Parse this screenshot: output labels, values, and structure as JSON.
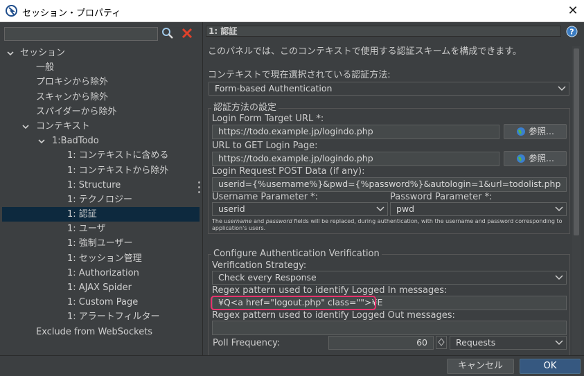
{
  "window": {
    "title": "セッション・プロパティ",
    "close_glyph": "✕"
  },
  "left": {
    "search_value": "",
    "tree": [
      {
        "label": "セッション",
        "expanded": true
      },
      {
        "label": "一般"
      },
      {
        "label": "プロキシから除外"
      },
      {
        "label": "スキャンから除外"
      },
      {
        "label": "スパイダーから除外"
      },
      {
        "label": "コンテキスト",
        "expanded": true
      },
      {
        "label": "1:BadTodo",
        "expanded": true
      },
      {
        "label": "1: コンテキストに含める"
      },
      {
        "label": "1: コンテキストから除外"
      },
      {
        "label": "1: Structure"
      },
      {
        "label": "1: テクノロジー"
      },
      {
        "label": "1: 認証",
        "selected": true
      },
      {
        "label": "1: ユーザ"
      },
      {
        "label": "1: 強制ユーザー"
      },
      {
        "label": "1: セッション管理"
      },
      {
        "label": "1: Authorization"
      },
      {
        "label": "1: AJAX Spider"
      },
      {
        "label": "1: Custom Page"
      },
      {
        "label": "1: アラートフィルター"
      },
      {
        "label": "Exclude from WebSockets"
      }
    ]
  },
  "panel": {
    "header": "1: 認証",
    "description": "このパネルでは、このコンテキストで使用する認証スキームを構成できます。",
    "method_label": "コンテキストで現在選択されている認証方法:",
    "method_value": "Form-based Authentication",
    "settings_title": "認証方法の設定",
    "login_form_label": "Login Form Target URL *:",
    "login_form_value": "https://todo.example.jp/logindo.php",
    "browse_label": "参照...",
    "login_page_label": "URL to GET Login Page:",
    "login_page_value": "https://todo.example.jp/logindo.php",
    "post_data_label": "Login Request POST Data (if any):",
    "post_data_value": "userid={%username%}&pwd={%password%}&autologin=1&url=todolist.php",
    "username_param_label": "Username Parameter *:",
    "username_param_value": "userid",
    "password_param_label": "Password Parameter *:",
    "password_param_value": "pwd",
    "note": {
      "pre": "The ",
      "u": "username",
      "mid": " and ",
      "p": "password",
      "post": " fields will be replaced, during authentication, with the username and password corresponding to application's users."
    },
    "verification_title": "Configure Authentication Verification",
    "strategy_label": "Verification Strategy:",
    "strategy_value": "Check every Response",
    "logged_in_label": "Regex pattern used to identify Logged In messages:",
    "logged_in_value": "¥Q<a href=\"logout.php\" class=\"\">¥E",
    "logged_out_label": "Regex pattern used to identify Logged Out messages:",
    "logged_out_value": "",
    "poll_label": "Poll Frequency:",
    "poll_value": "60",
    "poll_unit": "Requests"
  },
  "footer": {
    "cancel": "キャンセル",
    "ok": "OK"
  },
  "colors": {
    "selection": "#0d293e",
    "highlight": "#e8336e",
    "ok_button": "#365880",
    "clear_icon": "#e0422b"
  }
}
